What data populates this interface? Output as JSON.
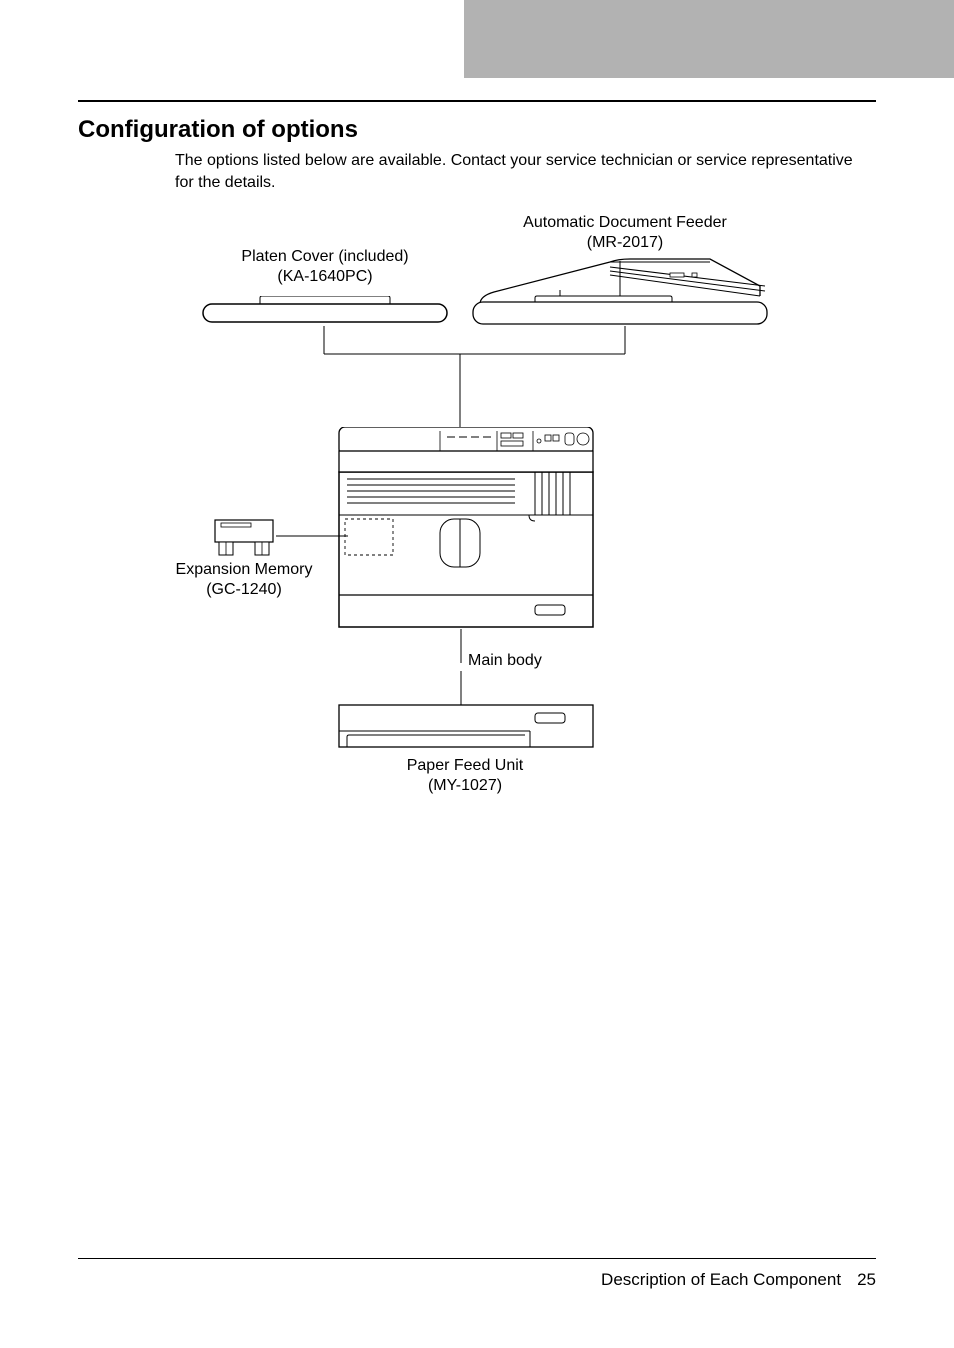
{
  "heading": "Configuration of options",
  "intro": "The options listed below are available. Contact your service technician or service representative for the details.",
  "labels": {
    "adf_name": "Automatic Document Feeder",
    "adf_model": "(MR-2017)",
    "platen_name": "Platen Cover (included)",
    "platen_model": "(KA-1640PC)",
    "mem_name": "Expansion Memory",
    "mem_model": "(GC-1240)",
    "main_body": "Main body",
    "pfu_name": "Paper Feed Unit",
    "pfu_model": "(MY-1027)"
  },
  "footer": {
    "section": "Description of Each Component",
    "page": "25"
  }
}
